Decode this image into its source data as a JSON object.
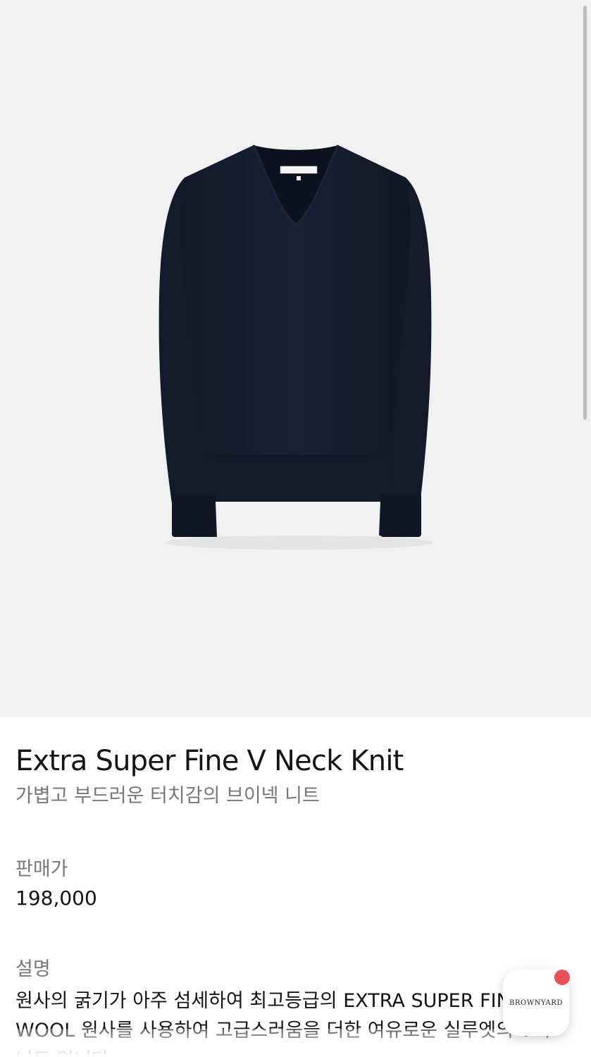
{
  "product": {
    "name": "Extra Super Fine V Neck Knit",
    "subtitle": "가볍고 부드러운 터치감의 브이넥 니트",
    "image_alt": "navy v-neck knit sweater",
    "price_label": "판매가",
    "price": "198,000",
    "description_label": "설명",
    "description": "원사의 굵기가 아주 섬세하여 최고등급의 EXTRA SUPER FINE WOOL 원사를 사용하여 고급스러움을 더한 여유로운 실루엣의 V넥 니트 입니다."
  },
  "chat_widget": {
    "brand_label": "BROWNYARD"
  },
  "colors": {
    "image_background": "#f1f1f1",
    "sweater_navy": "#151b2b",
    "notification_dot": "#e8505b"
  }
}
